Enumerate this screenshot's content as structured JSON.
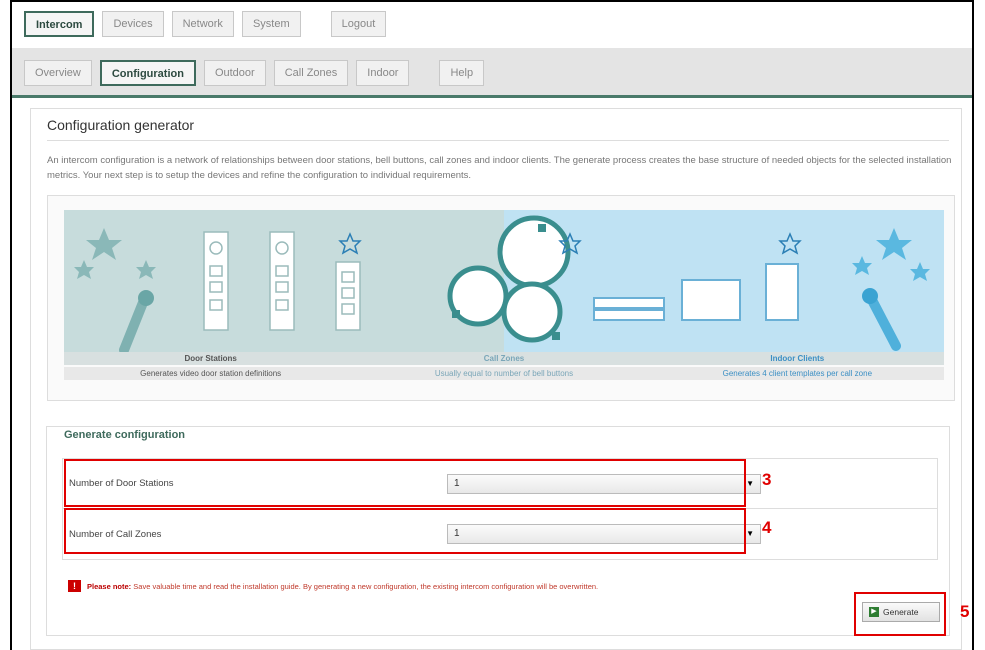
{
  "topnav": [
    "Intercom",
    "Devices",
    "Network",
    "System",
    "Logout"
  ],
  "subnav": [
    "Overview",
    "Configuration",
    "Outdoor",
    "Call Zones",
    "Indoor",
    "Help"
  ],
  "page": {
    "title": "Configuration generator",
    "description": "An intercom configuration is a network of relationships between door stations, bell buttons, call zones and indoor clients. The generate process creates the base structure of needed objects for the selected installation metrics. Your next step is to setup the devices and refine the configuration to individual requirements."
  },
  "illustration": {
    "captions": [
      "Door Stations",
      "Call Zones",
      "Indoor Clients"
    ],
    "subcaptions": [
      "Generates video door station definitions",
      "Usually equal to number of bell buttons",
      "Generates 4 client templates per call zone"
    ]
  },
  "generate": {
    "legend": "Generate configuration",
    "rows": [
      {
        "label": "Number of Door Stations",
        "value": "1"
      },
      {
        "label": "Number of Call Zones",
        "value": "1"
      }
    ],
    "note_prefix": "Please note:",
    "note_text": "Save valuable time and read the installation guide. By generating a new configuration, the existing intercom configuration will be overwritten.",
    "button": "Generate"
  },
  "annotations": [
    "3",
    "4",
    "5"
  ],
  "colors": {
    "accent": "#3e6a5c",
    "highlight": "#e00000"
  }
}
